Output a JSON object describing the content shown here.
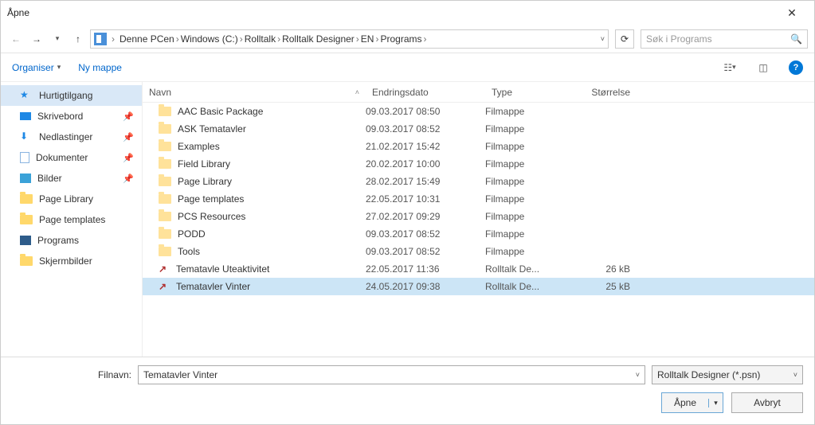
{
  "title": "Åpne",
  "nav": {
    "back_enabled": false,
    "fwd_enabled": true,
    "breadcrumbs": [
      "Denne PCen",
      "Windows (C:)",
      "Rolltalk",
      "Rolltalk Designer",
      "EN",
      "Programs"
    ]
  },
  "search": {
    "placeholder": "Søk i Programs"
  },
  "toolbar": {
    "organize": "Organiser",
    "newfolder": "Ny mappe"
  },
  "sidebar": {
    "items": [
      {
        "label": "Hurtigtilgang",
        "icon": "star",
        "active": true
      },
      {
        "label": "Skrivebord",
        "icon": "desk",
        "pinned": true
      },
      {
        "label": "Nedlastinger",
        "icon": "down",
        "pinned": true
      },
      {
        "label": "Dokumenter",
        "icon": "doc",
        "pinned": true
      },
      {
        "label": "Bilder",
        "icon": "img",
        "pinned": true
      },
      {
        "label": "Page Library",
        "icon": "folder"
      },
      {
        "label": "Page templates",
        "icon": "folder"
      },
      {
        "label": "Programs",
        "icon": "prog"
      },
      {
        "label": "Skjermbilder",
        "icon": "folder"
      }
    ]
  },
  "columns": {
    "name": "Navn",
    "date": "Endringsdato",
    "type": "Type",
    "size": "Størrelse"
  },
  "files": [
    {
      "name": "AAC Basic Package",
      "date": "09.03.2017 08:50",
      "type": "Filmappe",
      "size": "",
      "kind": "folder"
    },
    {
      "name": "ASK Tematavler",
      "date": "09.03.2017 08:52",
      "type": "Filmappe",
      "size": "",
      "kind": "folder"
    },
    {
      "name": "Examples",
      "date": "21.02.2017 15:42",
      "type": "Filmappe",
      "size": "",
      "kind": "folder"
    },
    {
      "name": "Field Library",
      "date": "20.02.2017 10:00",
      "type": "Filmappe",
      "size": "",
      "kind": "folder"
    },
    {
      "name": "Page Library",
      "date": "28.02.2017 15:49",
      "type": "Filmappe",
      "size": "",
      "kind": "folder"
    },
    {
      "name": "Page templates",
      "date": "22.05.2017 10:31",
      "type": "Filmappe",
      "size": "",
      "kind": "folder"
    },
    {
      "name": "PCS Resources",
      "date": "27.02.2017 09:29",
      "type": "Filmappe",
      "size": "",
      "kind": "folder"
    },
    {
      "name": "PODD",
      "date": "09.03.2017 08:52",
      "type": "Filmappe",
      "size": "",
      "kind": "folder"
    },
    {
      "name": "Tools",
      "date": "09.03.2017 08:52",
      "type": "Filmappe",
      "size": "",
      "kind": "folder"
    },
    {
      "name": "Tematavle Uteaktivitet",
      "date": "22.05.2017 11:36",
      "type": "Rolltalk De...",
      "size": "26 kB",
      "kind": "app"
    },
    {
      "name": "Tematavler Vinter",
      "date": "24.05.2017 09:38",
      "type": "Rolltalk De...",
      "size": "25 kB",
      "kind": "app",
      "selected": true
    }
  ],
  "footer": {
    "filename_label": "Filnavn:",
    "filename_value": "Tematavler Vinter",
    "filetype": "Rolltalk Designer (*.psn)",
    "open": "Åpne",
    "cancel": "Avbryt"
  }
}
